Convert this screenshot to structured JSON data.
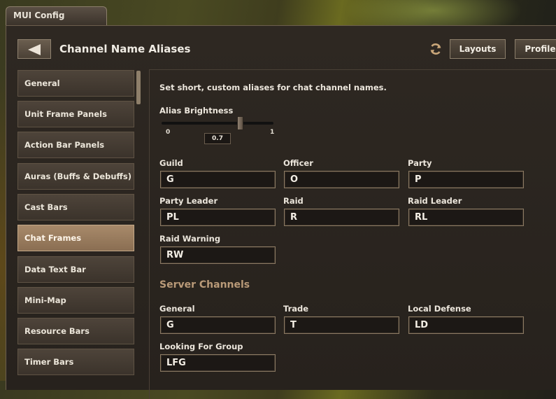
{
  "window": {
    "title": "MUI Config"
  },
  "header": {
    "title": "Channel Name Aliases",
    "layouts_label": "Layouts",
    "profiles_label": "Profiles",
    "refresh_icon": "refresh-icon",
    "back_icon": "arrow-left-icon"
  },
  "sidebar": {
    "items": [
      {
        "label": "General"
      },
      {
        "label": "Unit Frame Panels"
      },
      {
        "label": "Action Bar Panels"
      },
      {
        "label": "Auras (Buffs & Debuffs)"
      },
      {
        "label": "Cast Bars"
      },
      {
        "label": "Chat Frames",
        "active": true
      },
      {
        "label": "Data Text Bar"
      },
      {
        "label": "Mini-Map"
      },
      {
        "label": "Resource Bars"
      },
      {
        "label": "Timer Bars"
      }
    ]
  },
  "content": {
    "description": "Set short, custom aliases for chat channel names.",
    "slider": {
      "label": "Alias Brightness",
      "min": "0",
      "max": "1",
      "value": "0.7"
    },
    "fields": [
      {
        "label": "Guild",
        "value": "G"
      },
      {
        "label": "Officer",
        "value": "O"
      },
      {
        "label": "Party",
        "value": "P"
      },
      {
        "label": "Party Leader",
        "value": "PL"
      },
      {
        "label": "Raid",
        "value": "R"
      },
      {
        "label": "Raid Leader",
        "value": "RL"
      },
      {
        "label": "Raid Warning",
        "value": "RW"
      }
    ],
    "server_section_title": "Server Channels",
    "server_fields": [
      {
        "label": "General",
        "value": "G"
      },
      {
        "label": "Trade",
        "value": "T"
      },
      {
        "label": "Local Defense",
        "value": "LD"
      },
      {
        "label": "Looking For Group",
        "value": "LFG"
      }
    ]
  },
  "colors": {
    "accent": "#b99a78",
    "active_item": "#a88a6a",
    "panel_bg": "#2b251f"
  }
}
